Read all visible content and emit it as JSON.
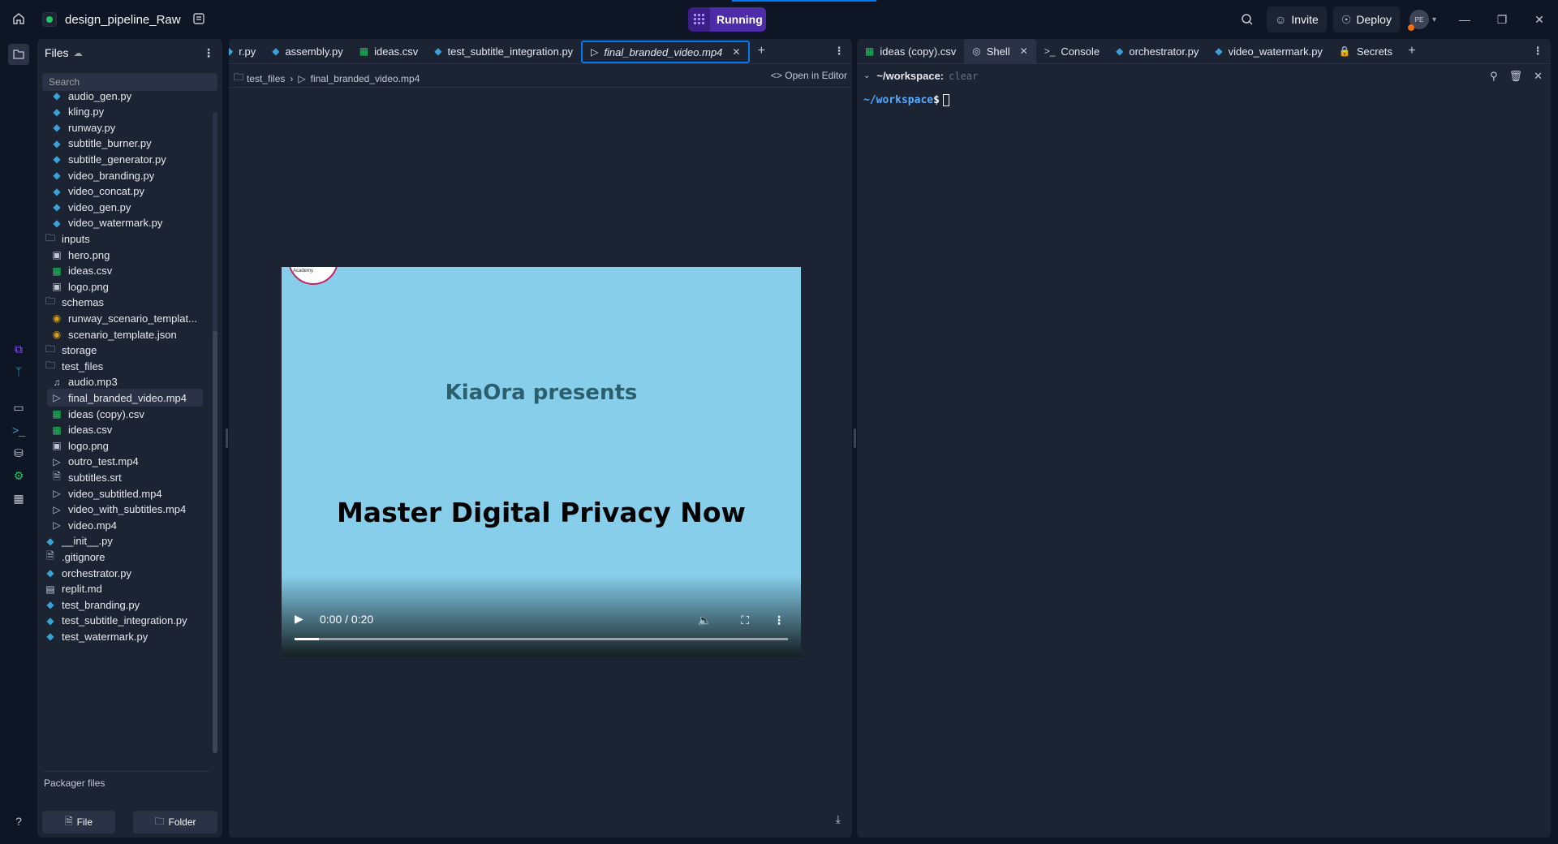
{
  "topbar": {
    "project_name": "design_pipeline_Raw",
    "run_label": "Running",
    "invite_label": "Invite",
    "deploy_label": "Deploy",
    "avatar_initials": "PE"
  },
  "sidebar": {
    "title": "Files",
    "search_placeholder": "Search",
    "items": [
      {
        "label": "audio_gen.py",
        "type": "py",
        "indent": 1
      },
      {
        "label": "kling.py",
        "type": "py",
        "indent": 1
      },
      {
        "label": "runway.py",
        "type": "py",
        "indent": 1
      },
      {
        "label": "subtitle_burner.py",
        "type": "py",
        "indent": 1
      },
      {
        "label": "subtitle_generator.py",
        "type": "py",
        "indent": 1
      },
      {
        "label": "video_branding.py",
        "type": "py",
        "indent": 1
      },
      {
        "label": "video_concat.py",
        "type": "py",
        "indent": 1
      },
      {
        "label": "video_gen.py",
        "type": "py",
        "indent": 1
      },
      {
        "label": "video_watermark.py",
        "type": "py",
        "indent": 1
      },
      {
        "label": "inputs",
        "type": "folder",
        "indent": 0
      },
      {
        "label": "hero.png",
        "type": "image",
        "indent": 1
      },
      {
        "label": "ideas.csv",
        "type": "csv",
        "indent": 1
      },
      {
        "label": "logo.png",
        "type": "image",
        "indent": 1
      },
      {
        "label": "schemas",
        "type": "folder",
        "indent": 0
      },
      {
        "label": "runway_scenario_templat...",
        "type": "json",
        "indent": 1
      },
      {
        "label": "scenario_template.json",
        "type": "json",
        "indent": 1
      },
      {
        "label": "storage",
        "type": "folder",
        "indent": 0
      },
      {
        "label": "test_files",
        "type": "folder",
        "indent": 0
      },
      {
        "label": "audio.mp3",
        "type": "audio",
        "indent": 1
      },
      {
        "label": "final_branded_video.mp4",
        "type": "video",
        "indent": 1,
        "selected": true
      },
      {
        "label": "ideas (copy).csv",
        "type": "csv",
        "indent": 1
      },
      {
        "label": "ideas.csv",
        "type": "csv",
        "indent": 1
      },
      {
        "label": "logo.png",
        "type": "image",
        "indent": 1
      },
      {
        "label": "outro_test.mp4",
        "type": "video",
        "indent": 1
      },
      {
        "label": "subtitles.srt",
        "type": "file",
        "indent": 1
      },
      {
        "label": "video_subtitled.mp4",
        "type": "video",
        "indent": 1
      },
      {
        "label": "video_with_subtitles.mp4",
        "type": "video",
        "indent": 1
      },
      {
        "label": "video.mp4",
        "type": "video",
        "indent": 1
      },
      {
        "label": "__init__.py",
        "type": "py",
        "indent": 0
      },
      {
        "label": ".gitignore",
        "type": "file",
        "indent": 0
      },
      {
        "label": "orchestrator.py",
        "type": "py",
        "indent": 0
      },
      {
        "label": "replit.md",
        "type": "md",
        "indent": 0
      },
      {
        "label": "test_branding.py",
        "type": "py",
        "indent": 0
      },
      {
        "label": "test_subtitle_integration.py",
        "type": "py",
        "indent": 0
      },
      {
        "label": "test_watermark.py",
        "type": "py",
        "indent": 0
      }
    ],
    "packager_label": "Packager files",
    "new_file_label": "File",
    "new_folder_label": "Folder"
  },
  "left_pane": {
    "tabs": [
      {
        "label": "r.py",
        "type": "py"
      },
      {
        "label": "assembly.py",
        "type": "py"
      },
      {
        "label": "ideas.csv",
        "type": "csv"
      },
      {
        "label": "test_subtitle_integration.py",
        "type": "py"
      },
      {
        "label": "final_branded_video.mp4",
        "type": "video",
        "active": true
      }
    ],
    "breadcrumb": [
      "test_files",
      "final_branded_video.mp4"
    ],
    "open_in_editor": "Open in Editor",
    "video": {
      "logo_text": "Academy",
      "presents_text": "KiaOra presents",
      "title_text": "Master Digital Privacy Now",
      "time": "0:00 / 0:20",
      "progress": 0.05
    }
  },
  "right_pane": {
    "tabs": [
      {
        "label": "ideas (copy).csv",
        "type": "csv"
      },
      {
        "label": "Shell",
        "type": "shell",
        "active": true
      },
      {
        "label": "Console",
        "type": "console"
      },
      {
        "label": "orchestrator.py",
        "type": "py"
      },
      {
        "label": "video_watermark.py",
        "type": "py"
      },
      {
        "label": "Secrets",
        "type": "lock"
      }
    ],
    "terminal": {
      "header_path": "~/workspace:",
      "header_cmd": "clear",
      "prompt_path": "~/workspace",
      "prompt_symbol": "$"
    }
  },
  "colors": {
    "bg": "#0e1525",
    "panel": "#1c2333",
    "accent": "#0079f2",
    "run": "#4e2ba8",
    "video_bg": "#87ceeb"
  }
}
